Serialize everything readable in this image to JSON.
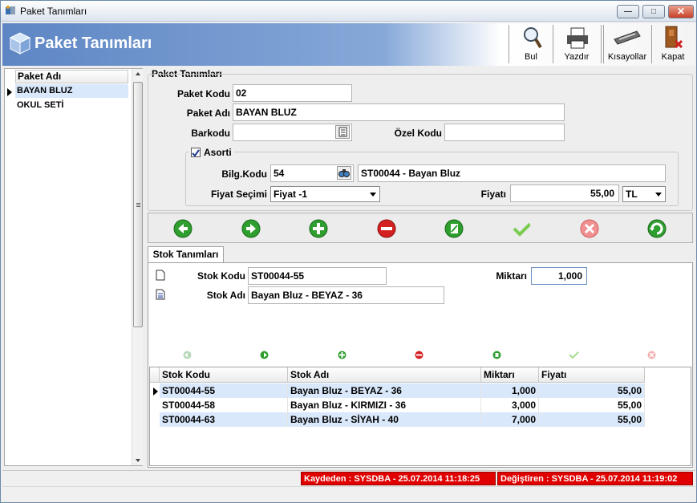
{
  "window": {
    "title": "Paket Tanımları",
    "minimize": "—",
    "maximize": "□",
    "close": "✕"
  },
  "banner": {
    "title": "Paket Tanımları"
  },
  "toolbar": {
    "find": "Bul",
    "print": "Yazdır",
    "shortcuts": "Kısayollar",
    "close": "Kapat"
  },
  "left_list": {
    "header": "Paket Adı",
    "items": [
      "BAYAN BLUZ",
      "OKUL SETİ"
    ]
  },
  "form": {
    "group_title": "Paket Tanımları",
    "paket_kodu_label": "Paket Kodu",
    "paket_kodu": "02",
    "paket_adi_label": "Paket Adı",
    "paket_adi": "BAYAN BLUZ",
    "barkodu_label": "Barkodu",
    "barkodu": "",
    "ozel_kodu_label": "Özel Kodu",
    "ozel_kodu": "",
    "asorti_label": "Asorti",
    "asorti_checked": true,
    "bilg_kodu_label": "Bilg.Kodu",
    "bilg_kodu": "54",
    "bilg_desc": "ST00044 - Bayan Bluz",
    "fiyat_secimi_label": "Fiyat Seçimi",
    "fiyat_secimi": "Fiyat -1",
    "fiyati_label": "Fiyatı",
    "fiyati": "55,00",
    "currency": "TL"
  },
  "stok_tab": {
    "tab_label": "Stok Tanımları",
    "stok_kodu_label": "Stok Kodu",
    "stok_kodu": "ST00044-55",
    "miktari_label": "Miktarı",
    "miktari": "1,000",
    "stok_adi_label": "Stok Adı",
    "stok_adi": "Bayan Bluz - BEYAZ - 36"
  },
  "grid": {
    "columns": [
      "Stok Kodu",
      "Stok Adı",
      "Miktarı",
      "Fiyatı"
    ],
    "rows": [
      [
        "ST00044-55",
        "Bayan Bluz - BEYAZ - 36",
        "1,000",
        "55,00"
      ],
      [
        "ST00044-58",
        "Bayan Bluz - KIRMIZI - 36",
        "3,000",
        "55,00"
      ],
      [
        "ST00044-63",
        "Bayan Bluz - SİYAH - 40",
        "7,000",
        "55,00"
      ]
    ]
  },
  "status": {
    "saved_by": "Kaydeden : SYSDBA - 25.07.2014 11:18:25",
    "changed_by": "Değiştiren : SYSDBA - 25.07.2014 11:19:02"
  },
  "colors": {
    "banner": "#6a92cc",
    "selected_row": "#d9e8fb",
    "status_red": "#e00000",
    "nav_green": "#2e9e2e",
    "nav_red": "#d42020"
  }
}
